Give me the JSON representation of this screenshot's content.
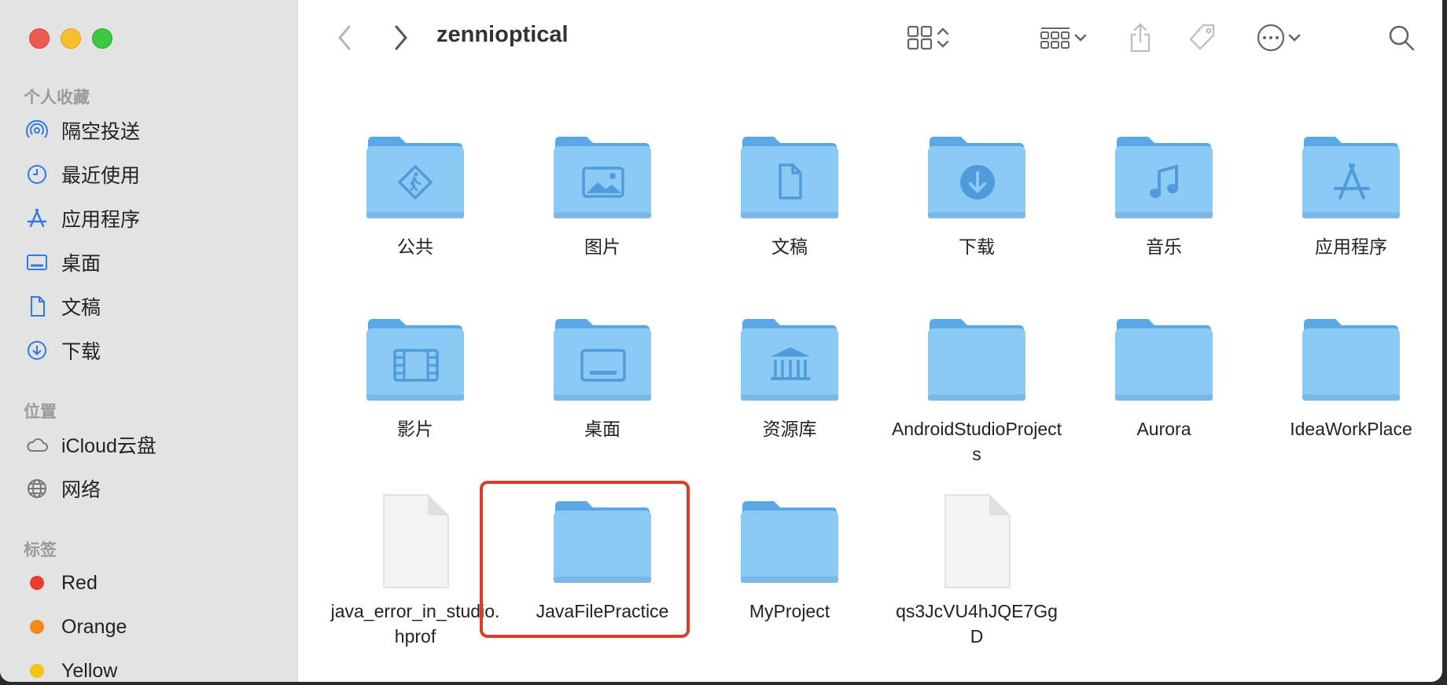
{
  "window": {
    "title": "zennioptical"
  },
  "sidebar": {
    "favorites_header": "个人收藏",
    "favorites": [
      {
        "label": "隔空投送",
        "icon": "airdrop-icon"
      },
      {
        "label": "最近使用",
        "icon": "clock-icon"
      },
      {
        "label": "应用程序",
        "icon": "applications-icon"
      },
      {
        "label": "桌面",
        "icon": "desktop-icon"
      },
      {
        "label": "文稿",
        "icon": "document-icon"
      },
      {
        "label": "下载",
        "icon": "download-icon"
      }
    ],
    "locations_header": "位置",
    "locations": [
      {
        "label": "iCloud云盘",
        "icon": "cloud-icon"
      },
      {
        "label": "网络",
        "icon": "globe-icon"
      }
    ],
    "tags_header": "标签",
    "tags": [
      {
        "label": "Red",
        "color": "#ee3b30"
      },
      {
        "label": "Orange",
        "color": "#f08a1c"
      },
      {
        "label": "Yellow",
        "color": "#f2c418"
      }
    ]
  },
  "toolbar": {
    "back": "chevron-left-icon",
    "forward": "chevron-right-icon",
    "view": "grid-view-icon",
    "group": "group-icon",
    "share": "share-icon",
    "tag": "tag-icon",
    "more": "ellipsis-icon",
    "search": "search-icon"
  },
  "items": [
    {
      "label": "公共",
      "kind": "folder",
      "glyph": "public"
    },
    {
      "label": "图片",
      "kind": "folder",
      "glyph": "pictures"
    },
    {
      "label": "文稿",
      "kind": "folder",
      "glyph": "documents"
    },
    {
      "label": "下载",
      "kind": "folder",
      "glyph": "downloads"
    },
    {
      "label": "音乐",
      "kind": "folder",
      "glyph": "music"
    },
    {
      "label": "应用程序",
      "kind": "folder",
      "glyph": "applications"
    },
    {
      "label": "影片",
      "kind": "folder",
      "glyph": "movies"
    },
    {
      "label": "桌面",
      "kind": "folder",
      "glyph": "desktop"
    },
    {
      "label": "资源库",
      "kind": "folder",
      "glyph": "library"
    },
    {
      "label": "AndroidStudioProjects",
      "kind": "folder",
      "glyph": ""
    },
    {
      "label": "Aurora",
      "kind": "folder",
      "glyph": ""
    },
    {
      "label": "IdeaWorkPlace",
      "kind": "folder",
      "glyph": ""
    },
    {
      "label": "java_error_in_studio.hprof",
      "kind": "file",
      "glyph": ""
    },
    {
      "label": "JavaFilePractice",
      "kind": "folder",
      "glyph": "",
      "highlighted": true
    },
    {
      "label": "MyProject",
      "kind": "folder",
      "glyph": ""
    },
    {
      "label": "qs3JcVU4hJQE7GgD",
      "kind": "file",
      "glyph": ""
    }
  ],
  "colors": {
    "folder_body": "#8ccaf6",
    "folder_back": "#5aa8e6",
    "folder_glyph": "#4f9bdb",
    "highlight": "#e03a2c"
  }
}
